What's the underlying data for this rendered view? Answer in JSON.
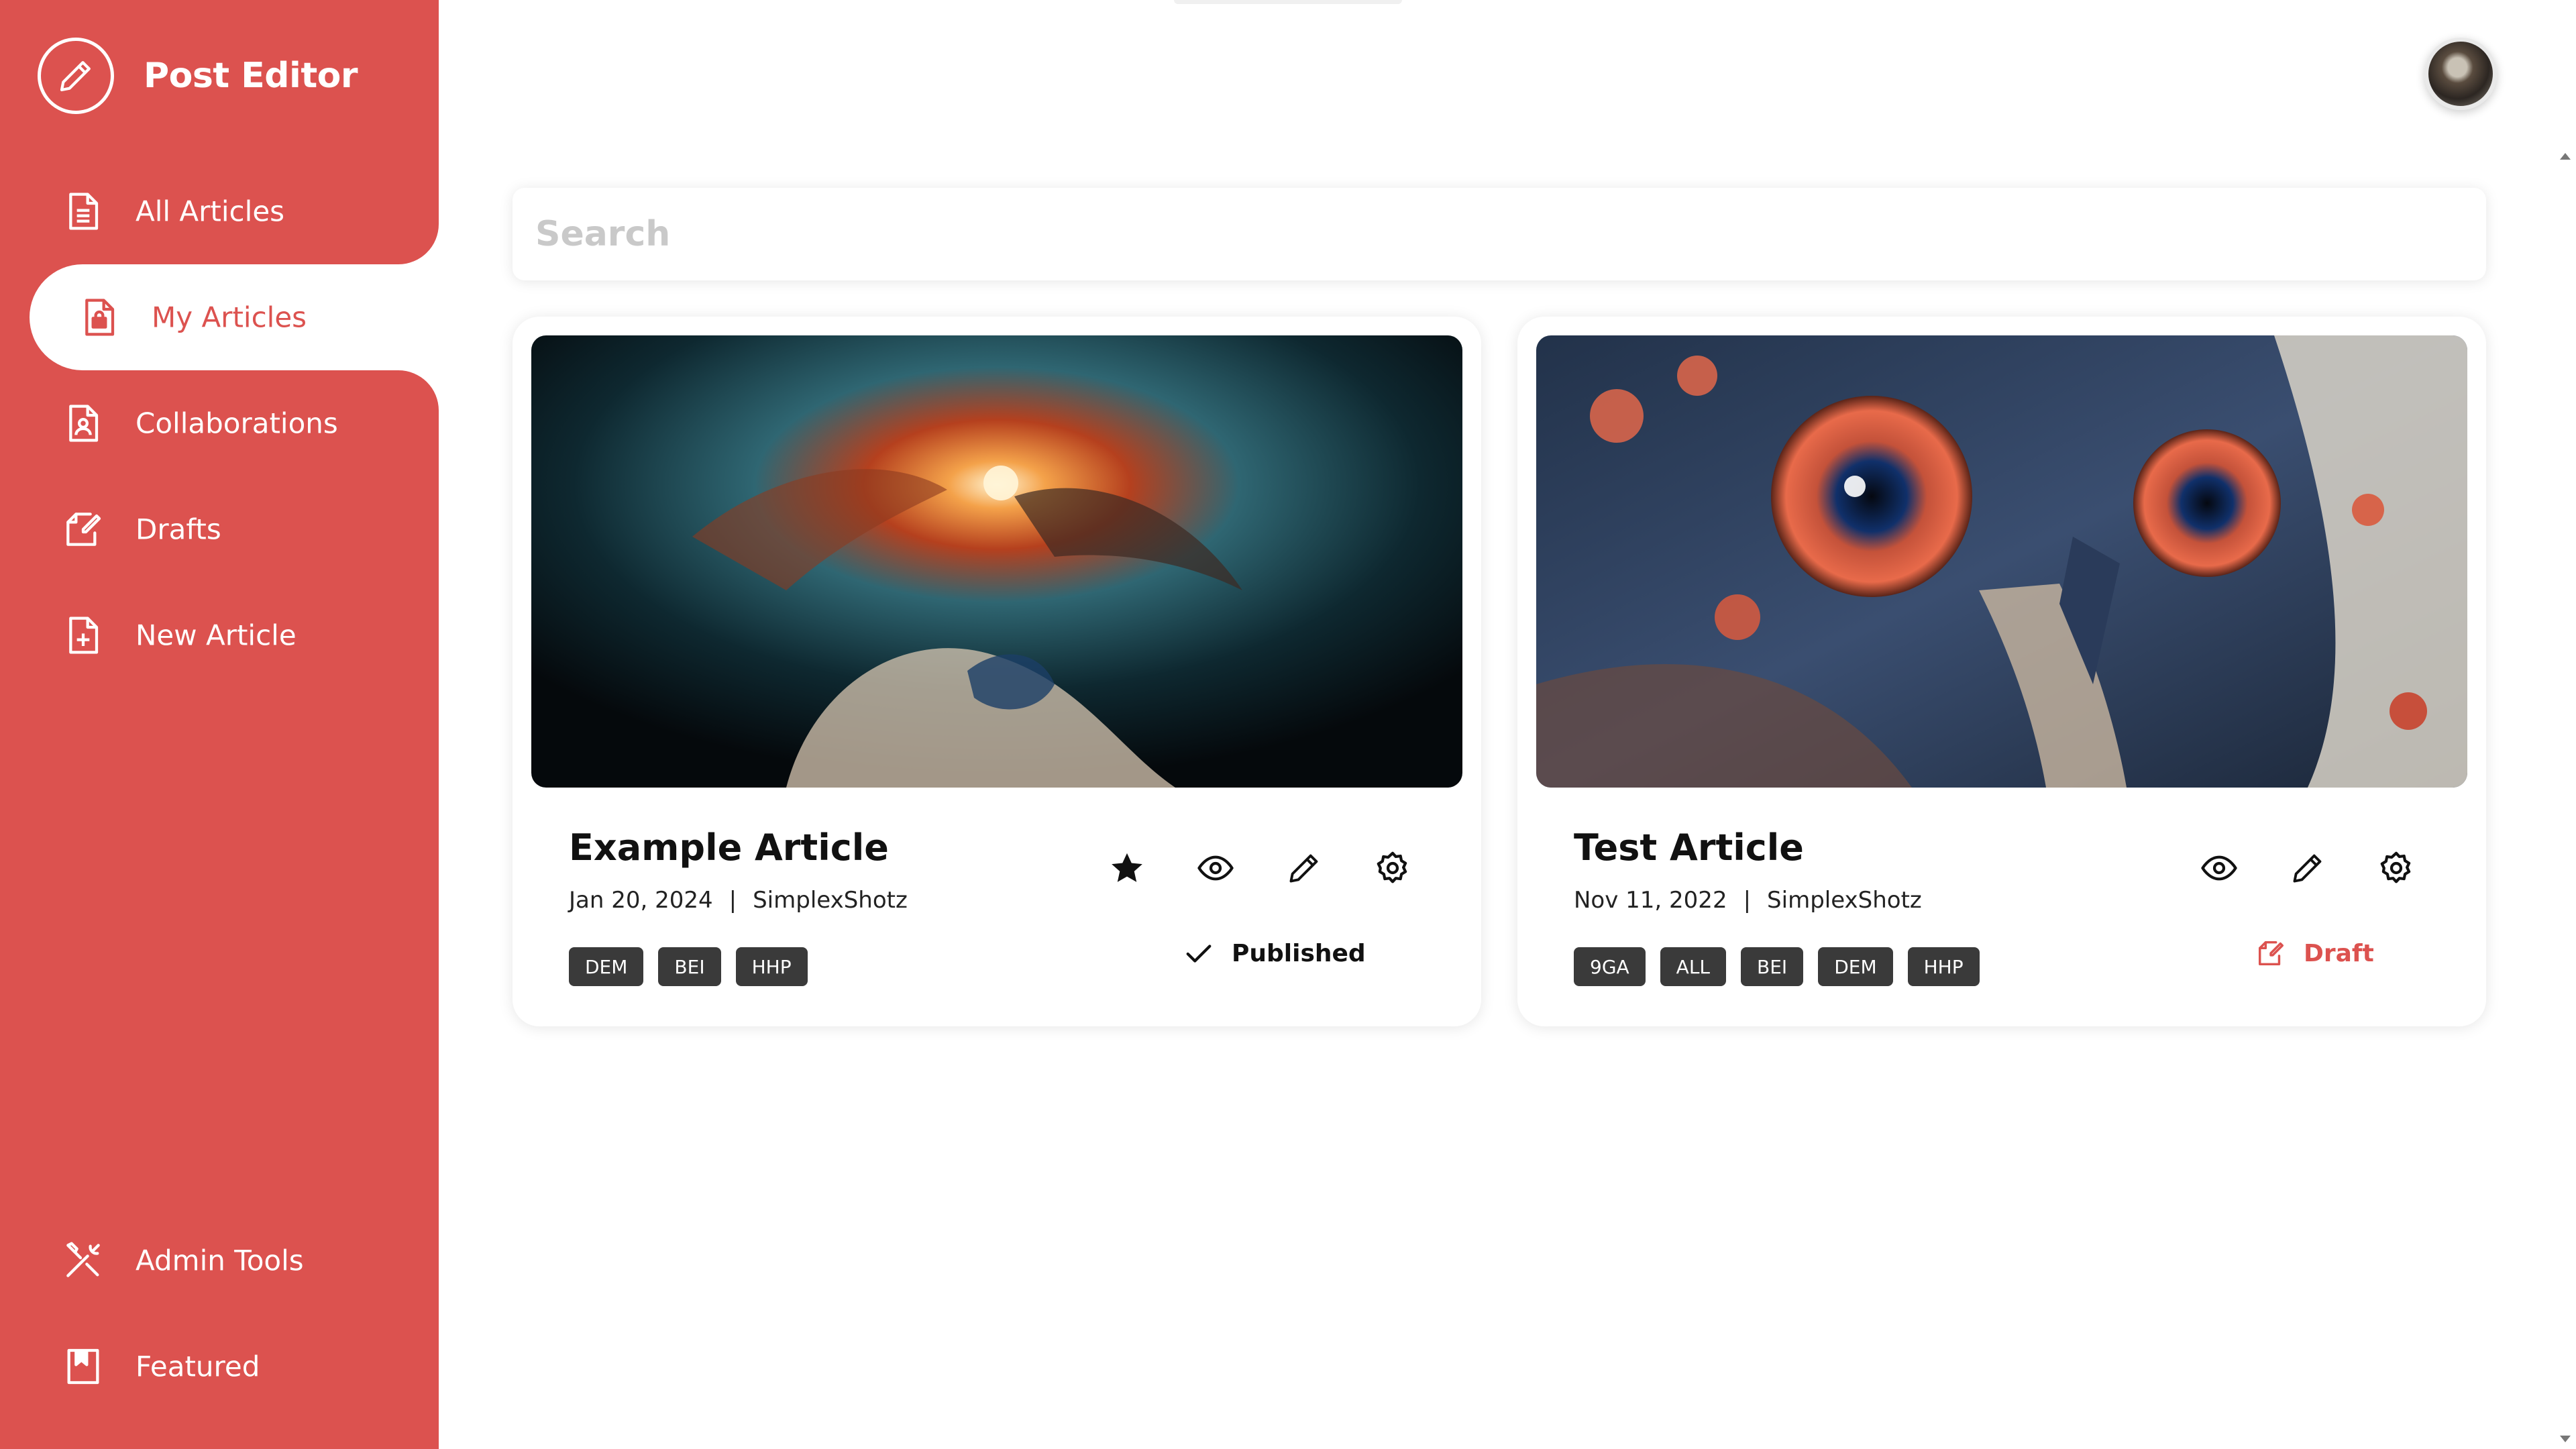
{
  "app": {
    "title": "Post Editor"
  },
  "sidebar": {
    "items": [
      {
        "label": "All Articles",
        "icon": "document-icon"
      },
      {
        "label": "My Articles",
        "icon": "locked-document-icon",
        "active": true
      },
      {
        "label": "Collaborations",
        "icon": "user-document-icon"
      },
      {
        "label": "Drafts",
        "icon": "draft-icon"
      },
      {
        "label": "New Article",
        "icon": "add-document-icon"
      }
    ],
    "bottom_items": [
      {
        "label": "Admin Tools",
        "icon": "tools-icon"
      },
      {
        "label": "Featured",
        "icon": "bookmark-icon"
      }
    ]
  },
  "search": {
    "placeholder": "Search",
    "value": ""
  },
  "articles": [
    {
      "title": "Example Article",
      "date": "Jan 20, 2024",
      "author": "SimplexShotz",
      "tags": [
        "DEM",
        "BEI",
        "HHP"
      ],
      "status": "Published",
      "featured": true,
      "actions": [
        "star-icon",
        "view-icon",
        "edit-icon",
        "settings-icon"
      ]
    },
    {
      "title": "Test Article",
      "date": "Nov 11, 2022",
      "author": "SimplexShotz",
      "tags": [
        "9GA",
        "ALL",
        "BEI",
        "DEM",
        "HHP"
      ],
      "status": "Draft",
      "featured": false,
      "actions": [
        "view-icon",
        "edit-icon",
        "settings-icon"
      ]
    }
  ],
  "colors": {
    "accent": "#dc524f",
    "tag_bg": "#3a3a3a",
    "page_bg": "#ffffff"
  },
  "separator": "|"
}
